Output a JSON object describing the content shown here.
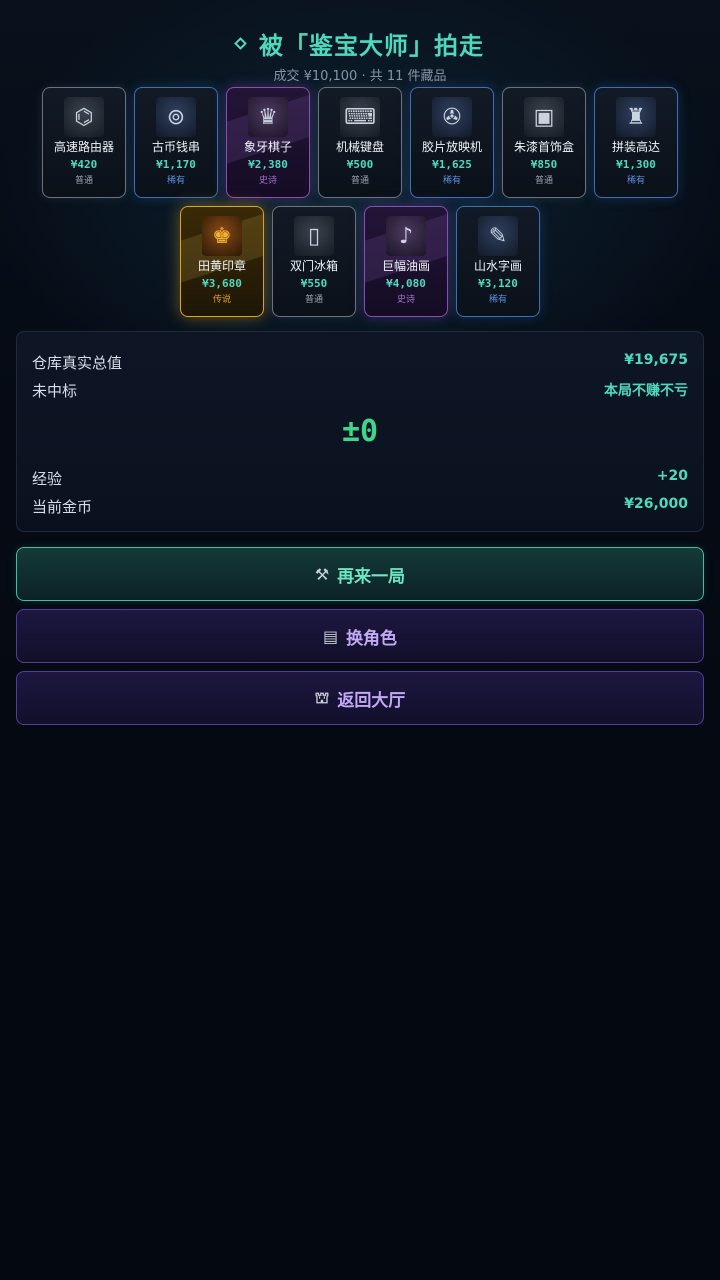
{
  "header": {
    "title": "被「鉴宝大师」拍走",
    "subtitle": "成交 ¥10,100 · 共 11 件藏品"
  },
  "items": [
    {
      "name": "高速路由器",
      "price": "¥420",
      "rarity": "普通",
      "tier": "common",
      "icon": "router-icon",
      "glyph": "⌬"
    },
    {
      "name": "古币钱串",
      "price": "¥1,170",
      "rarity": "稀有",
      "tier": "rare",
      "icon": "coin-string-icon",
      "glyph": "⊚"
    },
    {
      "name": "象牙棋子",
      "price": "¥2,380",
      "rarity": "史诗",
      "tier": "epic",
      "icon": "chess-piece-icon",
      "glyph": "♛"
    },
    {
      "name": "机械键盘",
      "price": "¥500",
      "rarity": "普通",
      "tier": "common",
      "icon": "keyboard-icon",
      "glyph": "⌨"
    },
    {
      "name": "胶片放映机",
      "price": "¥1,625",
      "rarity": "稀有",
      "tier": "rare",
      "icon": "film-projector-icon",
      "glyph": "✇"
    },
    {
      "name": "朱漆首饰盒",
      "price": "¥850",
      "rarity": "普通",
      "tier": "common",
      "icon": "jewelry-box-icon",
      "glyph": "▣"
    },
    {
      "name": "拼装高达",
      "price": "¥1,300",
      "rarity": "稀有",
      "tier": "rare",
      "icon": "robot-model-icon",
      "glyph": "♜"
    },
    {
      "name": "田黄印章",
      "price": "¥3,680",
      "rarity": "传说",
      "tier": "legend",
      "icon": "seal-stamp-icon",
      "glyph": "♚"
    },
    {
      "name": "双门冰箱",
      "price": "¥550",
      "rarity": "普通",
      "tier": "common",
      "icon": "fridge-icon",
      "glyph": "▯"
    },
    {
      "name": "巨幅油画",
      "price": "¥4,080",
      "rarity": "史诗",
      "tier": "epic",
      "icon": "piano-painting-icon",
      "glyph": "♪"
    },
    {
      "name": "山水字画",
      "price": "¥3,120",
      "rarity": "稀有",
      "tier": "rare",
      "icon": "scroll-painting-icon",
      "glyph": "✎"
    }
  ],
  "summary": {
    "warehouse_label": "仓库真实总值",
    "warehouse_value": "¥19,675",
    "result_label": "未中标",
    "result_value": "本局不赚不亏",
    "delta": "±0",
    "exp_label": "经验",
    "exp_value": "+20",
    "coins_label": "当前金币",
    "coins_value": "¥26,000"
  },
  "buttons": {
    "replay": "再来一局",
    "switch_role": "换角色",
    "back_lobby": "返回大厅"
  },
  "colors": {
    "accent": "#4fd9bc",
    "positive": "#3fd48a",
    "rare": "#5b8fe0",
    "epic": "#a070d0",
    "legend": "#e0a020"
  }
}
